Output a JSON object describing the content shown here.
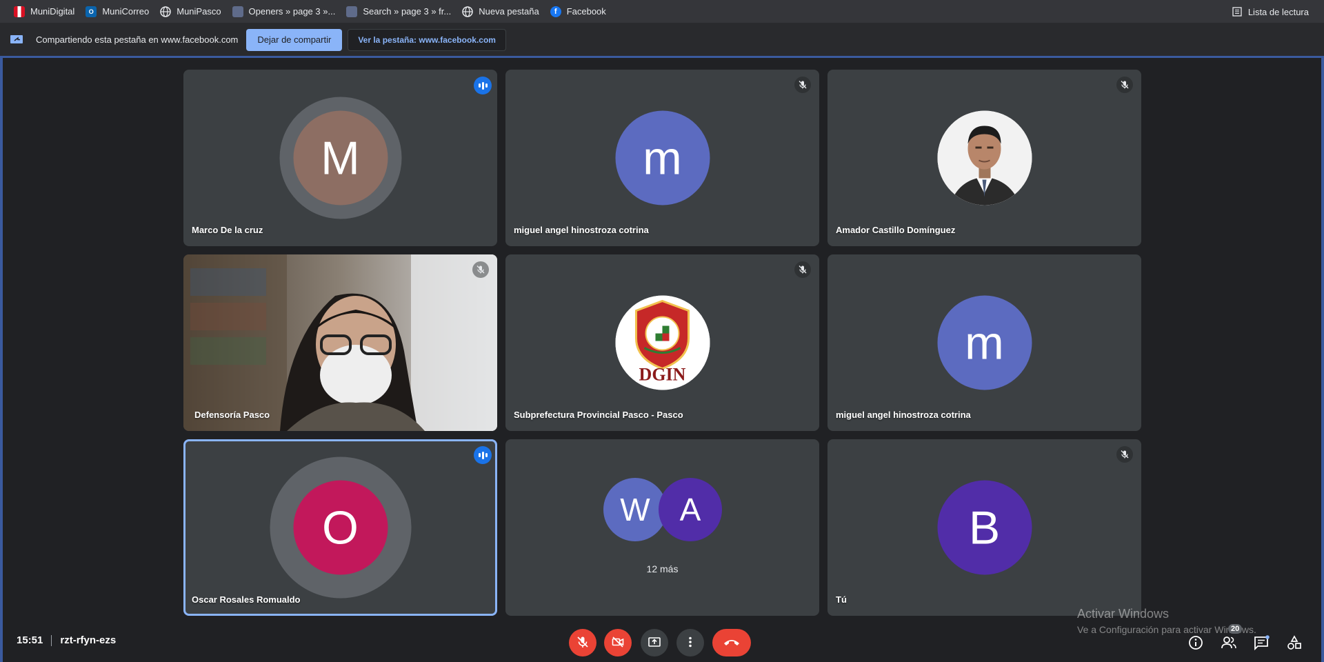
{
  "bookmarks": {
    "items": [
      {
        "label": "MuniDigital",
        "icon": "peru-flag-icon"
      },
      {
        "label": "MuniCorreo",
        "icon": "outlook-icon"
      },
      {
        "label": "MuniPasco",
        "icon": "globe-icon"
      },
      {
        "label": "Openers » page 3 »...",
        "icon": "image-icon"
      },
      {
        "label": "Search » page 3 » fr...",
        "icon": "image-icon"
      },
      {
        "label": "Nueva pestaña",
        "icon": "globe-icon"
      },
      {
        "label": "Facebook",
        "icon": "facebook-icon"
      }
    ],
    "reading_list": "Lista de lectura"
  },
  "sharebar": {
    "text": "Compartiendo esta pestaña en www.facebook.com",
    "stop_label": "Dejar de compartir",
    "view_label": "Ver la pestaña: www.facebook.com"
  },
  "tiles": [
    {
      "name": "Marco De la cruz",
      "initial": "M",
      "avatar_color": "#8d6e63",
      "status": "speaking"
    },
    {
      "name": "miguel angel hinostroza cotrina",
      "initial": "m",
      "avatar_color": "#5c6bc0",
      "status": "muted"
    },
    {
      "name": "Amador Castillo Domínguez",
      "initial": "",
      "avatar_color": "#ffffff",
      "status": "muted"
    },
    {
      "name": "Defensoría Pasco",
      "initial": "",
      "status": "muted"
    },
    {
      "name": "Subprefectura Provincial Pasco - Pasco",
      "initial": "",
      "logo_text": "DGIN",
      "status": "muted"
    },
    {
      "name": "miguel angel hinostroza cotrina",
      "initial": "m",
      "avatar_color": "#5c6bc0",
      "status": "none"
    },
    {
      "name": "Oscar Rosales Romualdo",
      "initial": "O",
      "avatar_color": "#c2185b",
      "status": "speaking"
    },
    {
      "name": "",
      "initials": [
        "W",
        "A"
      ],
      "more": "12 más",
      "status": "none"
    },
    {
      "name": "Tú",
      "initial": "B",
      "avatar_color": "#512da8",
      "status": "muted"
    }
  ],
  "meeting": {
    "time": "15:51",
    "code": "rzt-rfyn-ezs",
    "participants_count": "20"
  },
  "watermark": {
    "line1": "Activar Windows",
    "line2": "Ve a Configuración para activar Windows."
  },
  "colors": {
    "accent": "#8ab4f8",
    "danger": "#ea4335",
    "speaking": "#1a73e8"
  }
}
